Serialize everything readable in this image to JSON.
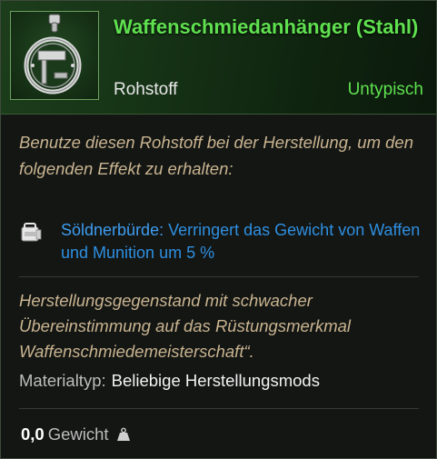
{
  "item": {
    "name": "Waffenschmiedanhänger (Stahl)",
    "type": "Rohstoff",
    "rarity": "Untypisch",
    "icon": "steel-pendant-icon"
  },
  "description": "Benutze diesen Rohstoff bei der Herstellung, um den folgenden Effekt zu erhalten:",
  "perk": {
    "icon": "backpack-icon",
    "name": "Söldnerbürde:",
    "text": "Verringert das Gewicht von Waffen und Munition um 5 %"
  },
  "flavor": "Herstellungsgegenstand mit schwacher Übereinstimmung auf das Rüstungsmerkmal Waffenschmiedemeisterschaft“.",
  "material": {
    "label": "Materialtyp:",
    "value": "Beliebige Herstellungsmods"
  },
  "weight": {
    "value": "0,0",
    "label": "Gewicht",
    "icon": "weight-icon"
  },
  "colors": {
    "title_green": "#5fe14f",
    "perk_blue": "#2e8fe0",
    "italic_tan": "#c9b490"
  }
}
